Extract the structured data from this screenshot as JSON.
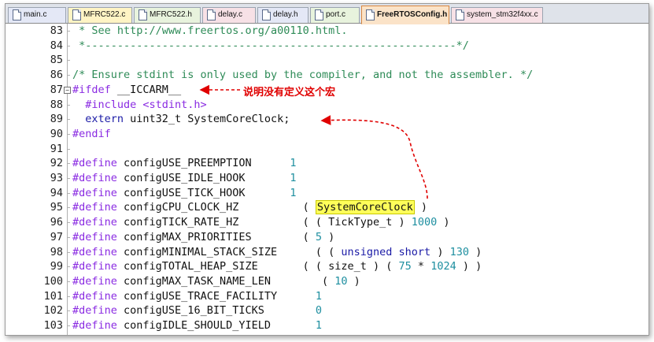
{
  "tabs": [
    {
      "label": "main.c",
      "color": "c-blue"
    },
    {
      "label": "MFRC522.c",
      "color": "c-yellow"
    },
    {
      "label": "MFRC522.h",
      "color": "c-green"
    },
    {
      "label": "delay.c",
      "color": "c-pink"
    },
    {
      "label": "delay.h",
      "color": "c-blue"
    },
    {
      "label": "port.c",
      "color": "c-green"
    },
    {
      "label": "FreeRTOSConfig.h",
      "color": "active"
    },
    {
      "label": "system_stm32f4xx.c",
      "color": "c-pink"
    }
  ],
  "lines": [
    {
      "n": "83",
      "segs": [
        {
          "t": " * See http://www.freertos.org/a00110.html.",
          "c": "cm"
        }
      ]
    },
    {
      "n": "84",
      "segs": [
        {
          "t": " *----------------------------------------------------------*/",
          "c": "cm"
        }
      ]
    },
    {
      "n": "85",
      "segs": []
    },
    {
      "n": "86",
      "segs": [
        {
          "t": "/* Ensure stdint is only used by the compiler, and not the assembler. */",
          "c": "cm"
        }
      ]
    },
    {
      "n": "87",
      "segs": [
        {
          "t": "#ifdef",
          "c": "pp"
        },
        {
          "t": " __ICCARM__",
          "c": ""
        }
      ]
    },
    {
      "n": "88",
      "segs": [
        {
          "t": "  #include ",
          "c": "pp"
        },
        {
          "t": "<stdint.h>",
          "c": "str"
        }
      ]
    },
    {
      "n": "89",
      "segs": [
        {
          "t": "  extern",
          "c": "kw"
        },
        {
          "t": " uint32_t SystemCoreClock;",
          "c": ""
        }
      ]
    },
    {
      "n": "90",
      "segs": [
        {
          "t": "#endif",
          "c": "pp"
        }
      ]
    },
    {
      "n": "91",
      "segs": []
    },
    {
      "n": "92",
      "segs": [
        {
          "t": "#define",
          "c": "pp"
        },
        {
          "t": " configUSE_PREEMPTION      ",
          "c": ""
        },
        {
          "t": "1",
          "c": "num"
        }
      ]
    },
    {
      "n": "93",
      "segs": [
        {
          "t": "#define",
          "c": "pp"
        },
        {
          "t": " configUSE_IDLE_HOOK       ",
          "c": ""
        },
        {
          "t": "1",
          "c": "num"
        }
      ]
    },
    {
      "n": "94",
      "segs": [
        {
          "t": "#define",
          "c": "pp"
        },
        {
          "t": " configUSE_TICK_HOOK       ",
          "c": ""
        },
        {
          "t": "1",
          "c": "num"
        }
      ]
    },
    {
      "n": "95",
      "segs": [
        {
          "t": "#define",
          "c": "pp"
        },
        {
          "t": " configCPU_CLOCK_HZ          ( ",
          "c": ""
        },
        {
          "t": "SystemCoreClock",
          "c": "hl"
        },
        {
          "t": " )",
          "c": ""
        }
      ]
    },
    {
      "n": "96",
      "segs": [
        {
          "t": "#define",
          "c": "pp"
        },
        {
          "t": " configTICK_RATE_HZ          ( ( TickType_t ) ",
          "c": ""
        },
        {
          "t": "1000",
          "c": "num"
        },
        {
          "t": " )",
          "c": ""
        }
      ]
    },
    {
      "n": "97",
      "segs": [
        {
          "t": "#define",
          "c": "pp"
        },
        {
          "t": " configMAX_PRIORITIES        ( ",
          "c": ""
        },
        {
          "t": "5",
          "c": "num"
        },
        {
          "t": " )",
          "c": ""
        }
      ]
    },
    {
      "n": "98",
      "segs": [
        {
          "t": "#define",
          "c": "pp"
        },
        {
          "t": " configMINIMAL_STACK_SIZE      ( ( ",
          "c": ""
        },
        {
          "t": "unsigned short",
          "c": "kw"
        },
        {
          "t": " ) ",
          "c": ""
        },
        {
          "t": "130",
          "c": "num"
        },
        {
          "t": " )",
          "c": ""
        }
      ]
    },
    {
      "n": "99",
      "segs": [
        {
          "t": "#define",
          "c": "pp"
        },
        {
          "t": " configTOTAL_HEAP_SIZE       ( ( size_t ) ( ",
          "c": ""
        },
        {
          "t": "75",
          "c": "num"
        },
        {
          "t": " * ",
          "c": ""
        },
        {
          "t": "1024",
          "c": "num"
        },
        {
          "t": " ) )",
          "c": ""
        }
      ]
    },
    {
      "n": "100",
      "segs": [
        {
          "t": "#define",
          "c": "pp"
        },
        {
          "t": " configMAX_TASK_NAME_LEN        ( ",
          "c": ""
        },
        {
          "t": "10",
          "c": "num"
        },
        {
          "t": " )",
          "c": ""
        }
      ]
    },
    {
      "n": "101",
      "segs": [
        {
          "t": "#define",
          "c": "pp"
        },
        {
          "t": " configUSE_TRACE_FACILITY      ",
          "c": ""
        },
        {
          "t": "1",
          "c": "num"
        }
      ]
    },
    {
      "n": "102",
      "segs": [
        {
          "t": "#define",
          "c": "pp"
        },
        {
          "t": " configUSE_16_BIT_TICKS        ",
          "c": ""
        },
        {
          "t": "0",
          "c": "num"
        }
      ]
    },
    {
      "n": "103",
      "segs": [
        {
          "t": "#define",
          "c": "pp"
        },
        {
          "t": " configIDLE_SHOULD_YIELD       ",
          "c": ""
        },
        {
          "t": "1",
          "c": "num"
        }
      ]
    }
  ],
  "annotation": "说明没有定义这个宏",
  "colors": {
    "annotation": "#e00000",
    "highlight": "#ffff5a",
    "active_tab": "#fbe3c8"
  }
}
